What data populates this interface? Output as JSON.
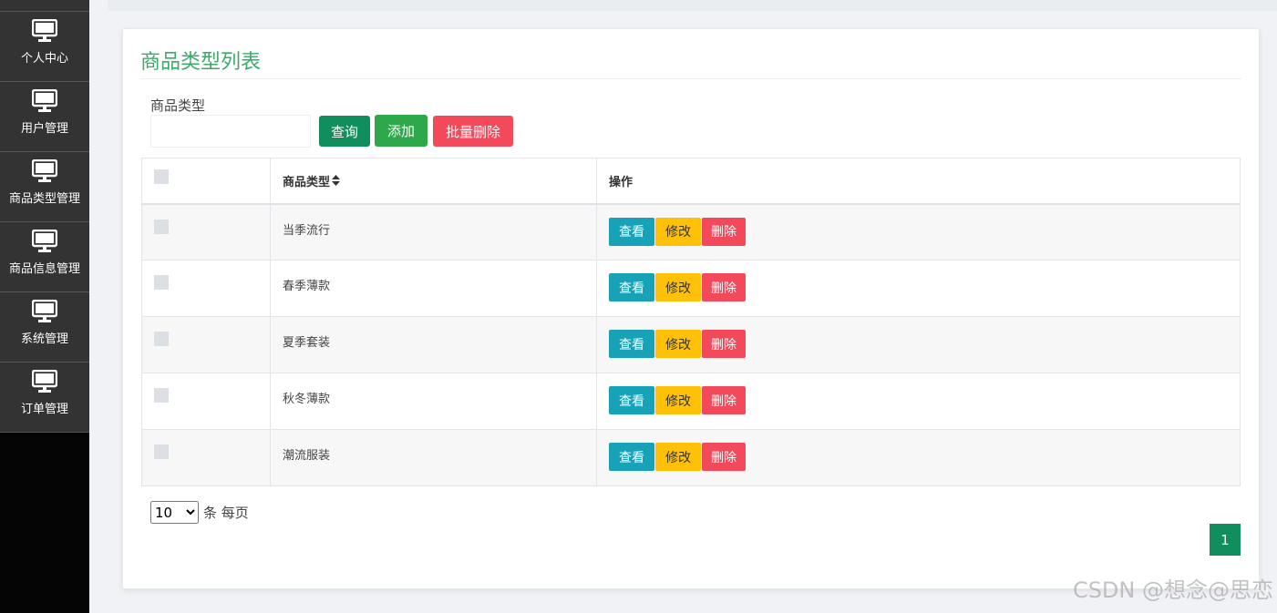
{
  "sidebar": {
    "items": [
      {
        "label": "个人中心",
        "icon": "monitor-icon"
      },
      {
        "label": "用户管理",
        "icon": "monitor-icon"
      },
      {
        "label": "商品类型管理",
        "icon": "monitor-icon"
      },
      {
        "label": "商品信息管理",
        "icon": "monitor-icon"
      },
      {
        "label": "系统管理",
        "icon": "monitor-icon"
      },
      {
        "label": "订单管理",
        "icon": "monitor-icon"
      }
    ]
  },
  "main": {
    "title": "商品类型列表",
    "search": {
      "label": "商品类型",
      "value": "",
      "placeholder": ""
    },
    "buttons": {
      "query": "查询",
      "add": "添加",
      "batch_delete": "批量删除"
    },
    "table": {
      "columns": [
        "商品类型",
        "操作"
      ],
      "rows": [
        {
          "type": "当季流行"
        },
        {
          "type": "春季薄款"
        },
        {
          "type": "夏季套装"
        },
        {
          "type": "秋冬薄款"
        },
        {
          "type": "潮流服装"
        }
      ],
      "actions": {
        "view": "查看",
        "edit": "修改",
        "delete": "删除"
      }
    },
    "pagination": {
      "page_size": "10",
      "page_size_options": [
        "10"
      ],
      "per_page_label": "条 每页",
      "current_page": "1"
    }
  },
  "watermark": "CSDN @想念@思恋",
  "colors": {
    "title": "#3daa6b",
    "primary": "#108f5c",
    "success": "#2ea84a",
    "danger": "#f24a5b",
    "info": "#17a2b8",
    "warning": "#ffc107",
    "sidebar": "#333333"
  }
}
